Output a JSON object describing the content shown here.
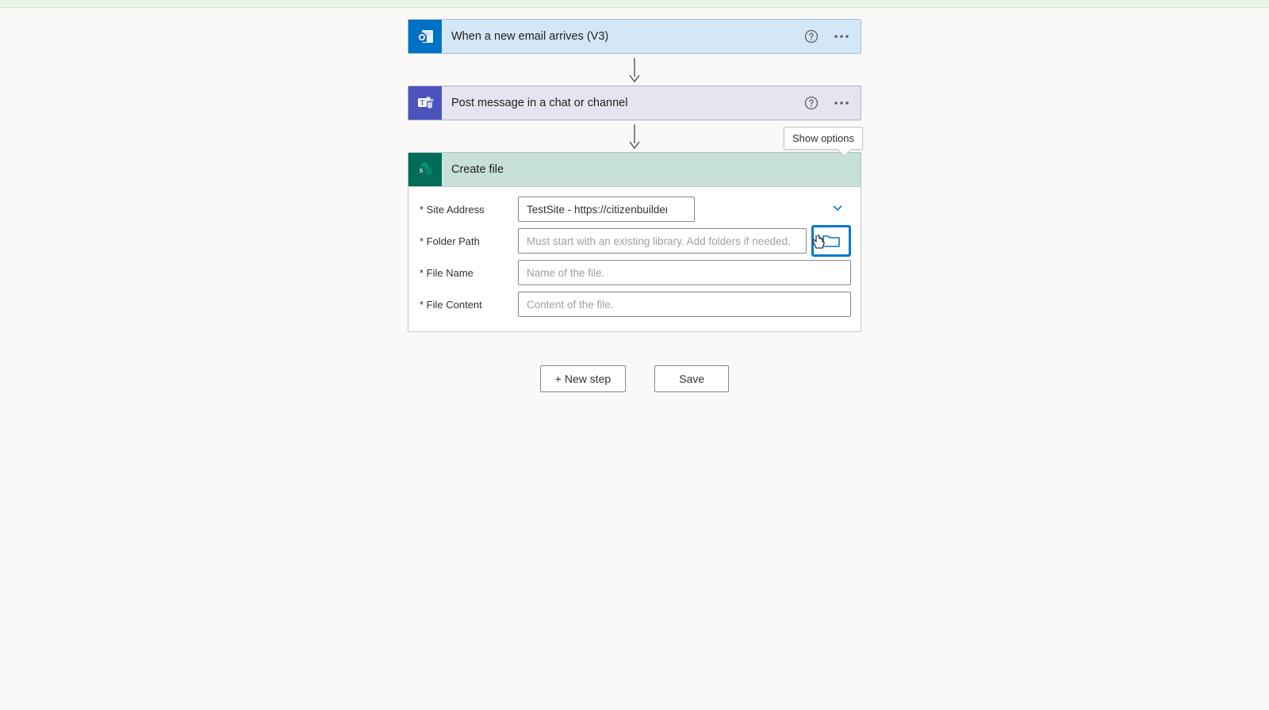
{
  "steps": {
    "outlook": {
      "title": "When a new email arrives (V3)"
    },
    "teams": {
      "title": "Post message in a chat or channel"
    },
    "sharepoint": {
      "title": "Create file",
      "show_options": "Show options",
      "fields": {
        "site_address": {
          "label": "* Site Address",
          "value": "TestSite - https://citizenbuilders.sharepoint.com/sites/TestSite"
        },
        "folder_path": {
          "label": "* Folder Path",
          "placeholder": "Must start with an existing library. Add folders if needed."
        },
        "file_name": {
          "label": "* File Name",
          "placeholder": "Name of the file."
        },
        "file_content": {
          "label": "* File Content",
          "placeholder": "Content of the file."
        }
      }
    }
  },
  "buttons": {
    "new_step": "+ New step",
    "save": "Save"
  }
}
